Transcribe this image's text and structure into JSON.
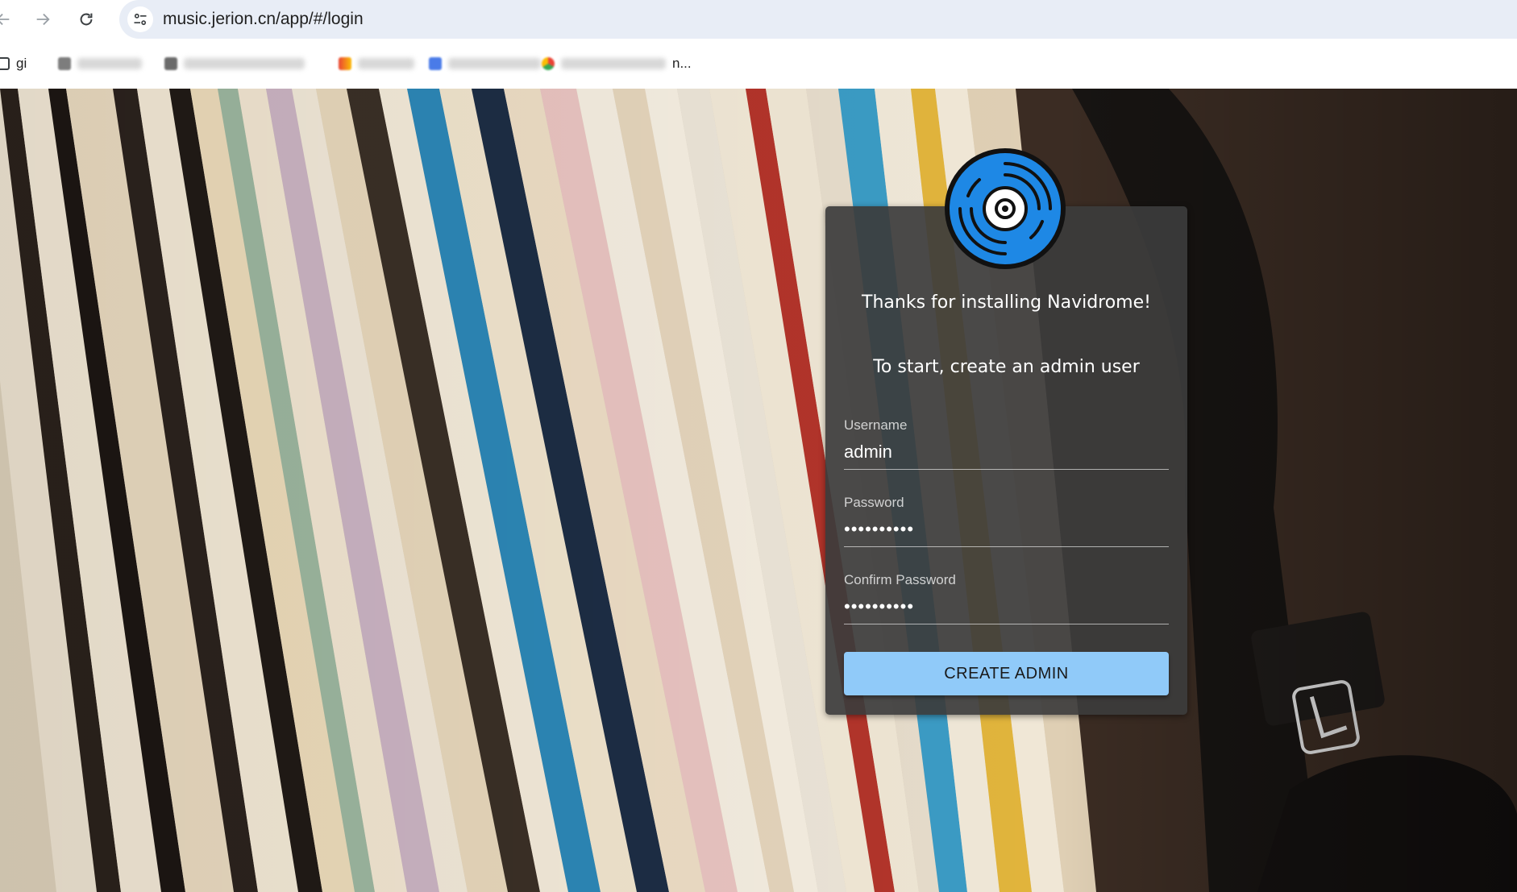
{
  "browser": {
    "url": "music.jerion.cn/app/#/login",
    "bookmarks": [
      {
        "label": "gi",
        "icon": "page-icon"
      },
      {
        "label": "",
        "icon": "folder-icon"
      },
      {
        "label": "",
        "icon": "bilibili-icon"
      },
      {
        "label": "",
        "icon": "gmail-icon"
      },
      {
        "label": "",
        "icon": "translate-icon"
      },
      {
        "label": "n...",
        "icon": "chrome-icon"
      }
    ]
  },
  "login": {
    "welcome": "Thanks for installing Navidrome!",
    "instruction": "To start, create an admin user",
    "username_label": "Username",
    "username_value": "admin",
    "password_label": "Password",
    "password_value": "••••••••••",
    "confirm_label": "Confirm Password",
    "confirm_value": "••••••••••",
    "submit_label": "CREATE ADMIN"
  },
  "colors": {
    "button": "#90caf9",
    "logo_blue": "#1e88e5",
    "card": "#3c3c3c"
  }
}
